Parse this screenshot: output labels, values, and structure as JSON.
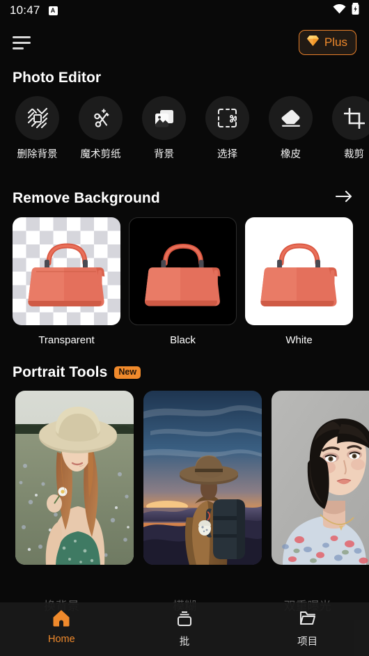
{
  "status_bar": {
    "time": "10:47",
    "app_badge_letter": "A",
    "icons": [
      "wifi-icon",
      "battery-charging-icon"
    ]
  },
  "top_bar": {
    "menu_icon": "hamburger-menu-icon",
    "plus": {
      "label": "Plus",
      "icon": "gem-diamond-icon",
      "accent": "#f08a2c"
    }
  },
  "photo_editor": {
    "title": "Photo Editor",
    "tools": [
      {
        "label": "删除背景",
        "icon": "remove-background-icon"
      },
      {
        "label": "魔术剪纸",
        "icon": "magic-cutout-scissors-icon"
      },
      {
        "label": "背景",
        "icon": "background-image-icon"
      },
      {
        "label": "选择",
        "icon": "select-marquee-icon"
      },
      {
        "label": "橡皮",
        "icon": "eraser-icon"
      },
      {
        "label": "裁剪",
        "icon": "crop-icon"
      }
    ]
  },
  "remove_background": {
    "title": "Remove Background",
    "arrow_icon": "arrow-right-icon",
    "cards": [
      {
        "label": "Transparent",
        "style": "checker"
      },
      {
        "label": "Black",
        "style": "black"
      },
      {
        "label": "White",
        "style": "white"
      }
    ]
  },
  "portrait_tools": {
    "title": "Portrait Tools",
    "badge": "New",
    "badge_color": "#f08a2c",
    "cards": [
      {
        "name": "woman-in-flower-field"
      },
      {
        "name": "hiker-with-backpack-at-sunset"
      },
      {
        "name": "woman-portrait-short-dark-hair"
      }
    ]
  },
  "background_labels": [
    "换背景",
    "模糊",
    "双重曝光"
  ],
  "bottom_nav": {
    "items": [
      {
        "label": "Home",
        "icon": "home-icon",
        "active": true
      },
      {
        "label": "批",
        "icon": "batch-icon",
        "active": false
      },
      {
        "label": "项目",
        "icon": "folder-projects-icon",
        "active": false
      }
    ]
  }
}
